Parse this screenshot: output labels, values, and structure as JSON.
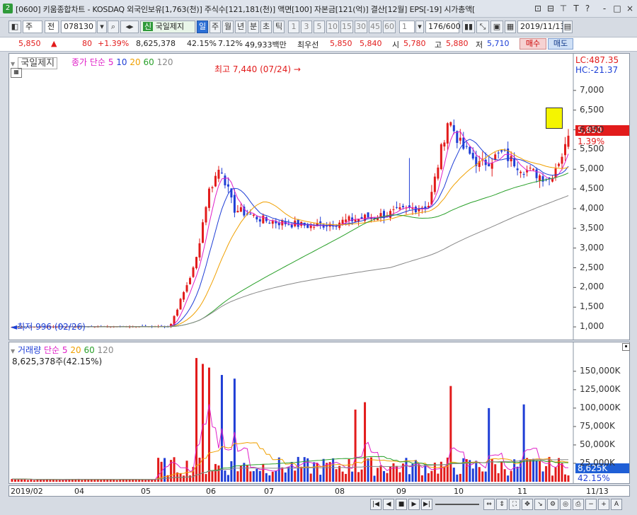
{
  "window": {
    "badge": "2",
    "title": "[0600] 키움종합차트 - KOSDAQ 외국인보유[1,763(천)] 주식수[121,181(천)] 액면[100] 자본금[121(억)] 결산[12월] EPS[-19] 시가총액[",
    "controls": [
      "⊡",
      "⊟",
      "⊤",
      "T",
      "?",
      "-",
      "□",
      "×"
    ]
  },
  "toolbar": {
    "market": "주",
    "view": "전",
    "code": "078130",
    "name": "국일제지",
    "periods": [
      "일",
      "주",
      "월",
      "년",
      "분",
      "초",
      "틱"
    ],
    "selected_period": "일",
    "intervals": [
      "1",
      "3",
      "5",
      "10",
      "15",
      "30",
      "45",
      "60"
    ],
    "interval_value": "1",
    "count": "176/600",
    "date": "2019/11/13"
  },
  "quote": {
    "price": "5,850",
    "arrow": "▲",
    "change": "80",
    "change_pct": "+1.39%",
    "volume": "8,625,378",
    "vol_ratio": "42.15%",
    "turnover": "7.12%",
    "amount": "49,933백만",
    "best_label": "최우선",
    "best_ask": "5,850",
    "best_bid": "5,840",
    "open_label": "시",
    "open": "5,780",
    "high_label": "고",
    "high": "5,880",
    "low_label": "저",
    "low": "5,710",
    "buy_label": "매수",
    "sell_label": "매도"
  },
  "price_panel": {
    "stock_name": "국일제지",
    "ma_legend": "종가 단순",
    "ma_periods": [
      "5",
      "10",
      "20",
      "60",
      "120"
    ],
    "ma_colors": [
      "#e020c8",
      "#1f3ed6",
      "#f0a000",
      "#2aa02a",
      "#888888"
    ],
    "lc_label": "LC:487.35",
    "hc_label": "HC:-21.37",
    "high_annotation": "최고 7,440 (07/24)",
    "low_annotation": "최저 996 (02/26)",
    "current_price_label": "5,850",
    "current_change_label": "1.39%"
  },
  "volume_panel": {
    "title": "거래량",
    "ma_legend": "단순",
    "ma_periods": [
      "5",
      "20",
      "60",
      "120"
    ],
    "ma_colors": [
      "#e020c8",
      "#f0a000",
      "#2aa02a",
      "#888888"
    ],
    "current_volume": "8,625,378주(42.15%)",
    "current_volume_label": "8,625K",
    "current_ratio_label": "42.15%"
  },
  "date_axis": {
    "labels": [
      "2019/02",
      "04",
      "05",
      "06",
      "07",
      "08",
      "09",
      "10",
      "11"
    ],
    "right_label": "11/13"
  },
  "chart_data": [
    {
      "type": "candlestick",
      "title": "국일제지 종가 단순",
      "y_ticks": [
        "7,000",
        "6,500",
        "6,000",
        "5,500",
        "5,000",
        "4,500",
        "4,000",
        "3,500",
        "3,000",
        "2,500",
        "2,000",
        "1,500",
        "1,000"
      ],
      "ylim": [
        750,
        7750
      ],
      "x_categories": [
        "2019/02",
        "04",
        "05",
        "06",
        "07",
        "08",
        "09",
        "10",
        "11"
      ],
      "approx_closes": [
        1000,
        1010,
        1020,
        3800,
        3600,
        3700,
        3900,
        6200,
        5200,
        5600,
        4900,
        5400,
        5850
      ],
      "high": 7440,
      "low": 996
    },
    {
      "type": "bar",
      "title": "거래량",
      "y_ticks": [
        "150,000K",
        "125,000K",
        "100,000K",
        "75,000K",
        "50,000K",
        "25,000K"
      ],
      "ylim": [
        0,
        170000
      ],
      "spikes_k": [
        168000,
        160000,
        155000,
        145000,
        140000,
        130000,
        108000,
        105000,
        100000,
        98000
      ],
      "current_k": 8625
    }
  ]
}
